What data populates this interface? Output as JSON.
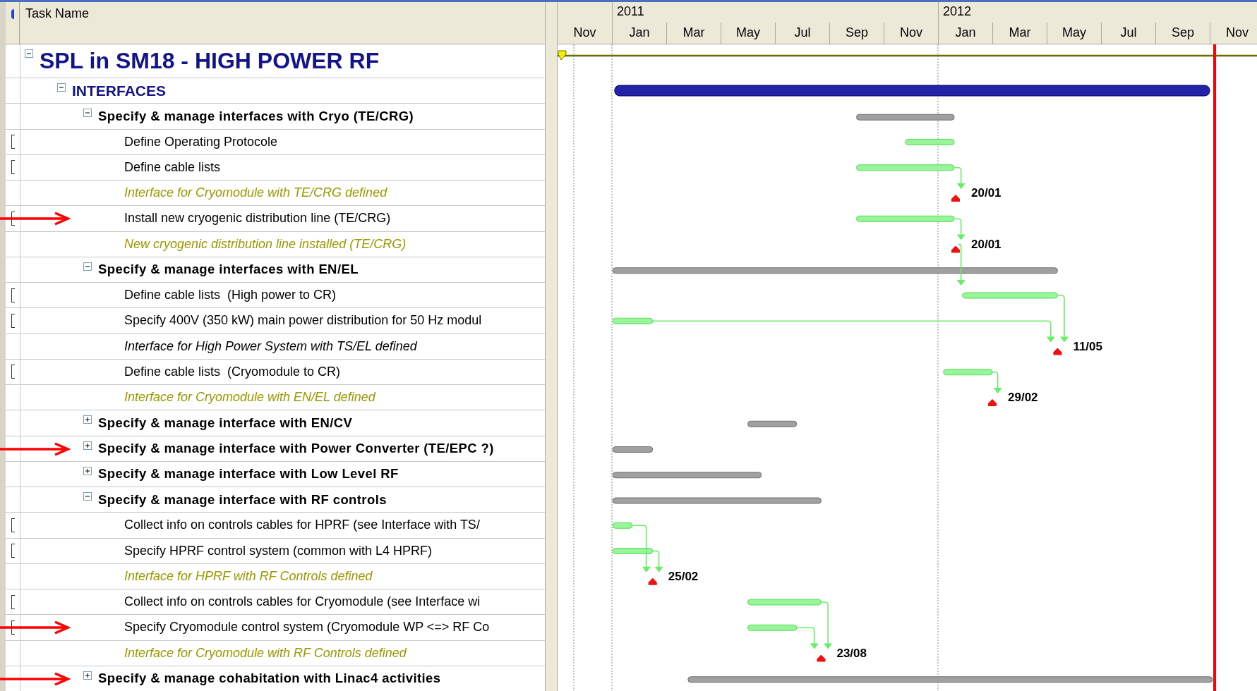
{
  "header": {
    "task_name": "Task Name"
  },
  "timeline": {
    "years": [
      "2011",
      "2012"
    ],
    "months": [
      "Nov",
      "Jan",
      "Mar",
      "May",
      "Jul",
      "Sep",
      "Nov",
      "Jan",
      "Mar",
      "May",
      "Jul",
      "Sep",
      "Nov"
    ]
  },
  "tasks": [
    {
      "name": "SPL in SM18 - HIGH POWER RF",
      "kind": "project",
      "expanded": true,
      "children": [
        {
          "name": "INTERFACES",
          "kind": "phase",
          "expanded": true,
          "children": [
            {
              "name": "Specify & manage interfaces with Cryo (TE/CRG)",
              "kind": "summary",
              "expanded": true,
              "children": [
                {
                  "name": "Define Operating Protocole",
                  "kind": "task",
                  "note": true
                },
                {
                  "name": "Define cable lists",
                  "kind": "task",
                  "note": true
                },
                {
                  "name": "Interface for Cryomodule with TE/CRG defined",
                  "kind": "milestone",
                  "color": "#999900",
                  "date": "20/01"
                },
                {
                  "name": "Install new cryogenic distribution line (TE/CRG)",
                  "kind": "task",
                  "note": true,
                  "flagged": true
                },
                {
                  "name": "New cryogenic distribution line installed (TE/CRG)",
                  "kind": "milestone",
                  "color": "#999900",
                  "date": "20/01"
                }
              ]
            },
            {
              "name": "Specify & manage interfaces with EN/EL",
              "kind": "summary",
              "expanded": true,
              "children": [
                {
                  "name": "Define cable lists  (High power to CR)",
                  "kind": "task",
                  "note": true
                },
                {
                  "name": "Specify 400V (350 kW) main power distribution for 50 Hz modul",
                  "kind": "task",
                  "note": true
                },
                {
                  "name": "Interface for High Power System with TS/EL defined",
                  "kind": "milestone",
                  "color": "#000000",
                  "date": "11/05"
                },
                {
                  "name": "Define cable lists  (Cryomodule to CR)",
                  "kind": "task",
                  "note": true
                },
                {
                  "name": "Interface for Cryomodule with EN/EL defined",
                  "kind": "milestone",
                  "color": "#999900",
                  "date": "29/02"
                }
              ]
            },
            {
              "name": "Specify & manage interface with EN/CV",
              "kind": "summary",
              "expanded": false
            },
            {
              "name": "Specify & manage interface with Power Converter (TE/EPC ?)",
              "kind": "summary",
              "expanded": false,
              "flagged": true
            },
            {
              "name": "Specify & manage interface with Low Level RF",
              "kind": "summary",
              "expanded": false
            },
            {
              "name": "Specify & manage interface with RF controls",
              "kind": "summary",
              "expanded": true,
              "children": [
                {
                  "name": "Collect info on controls cables for HPRF (see Interface with TS/",
                  "kind": "task",
                  "note": true
                },
                {
                  "name": "Specify HPRF control system (common with L4 HPRF)",
                  "kind": "task",
                  "note": true
                },
                {
                  "name": "Interface for HPRF with RF Controls defined",
                  "kind": "milestone",
                  "color": "#999900",
                  "date": "25/02"
                },
                {
                  "name": "Collect info on controls cables for Cryomodule (see Interface wi",
                  "kind": "task",
                  "note": true
                },
                {
                  "name": "Specify Cryomodule control system (Cryomodule WP <=> RF Co",
                  "kind": "task",
                  "note": true,
                  "flagged": true
                },
                {
                  "name": "Interface for Cryomodule with RF Controls defined",
                  "kind": "milestone",
                  "color": "#999900",
                  "date": "23/08"
                }
              ]
            },
            {
              "name": "Specify & manage cohabitation with Linac4 activities",
              "kind": "summary",
              "expanded": false,
              "flagged": true
            }
          ]
        }
      ]
    }
  ]
}
